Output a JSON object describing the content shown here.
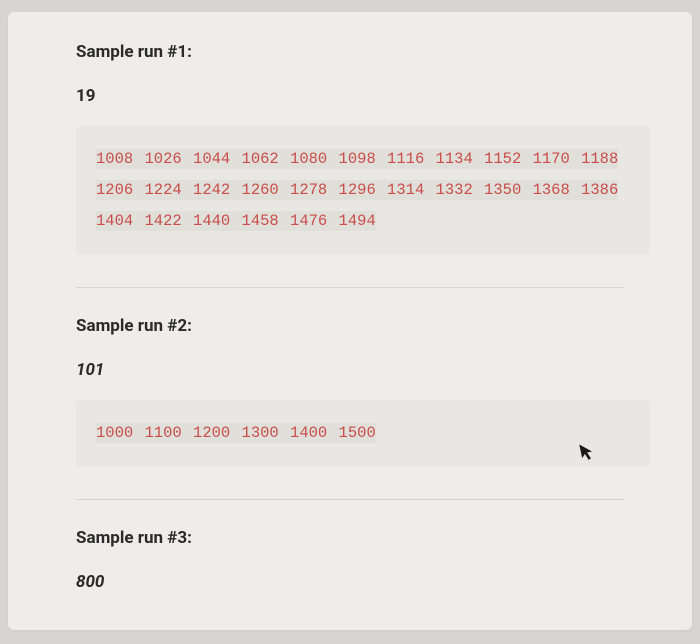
{
  "runs": [
    {
      "heading": "Sample run #1:",
      "input": "19",
      "input_italic": false,
      "output": "1008 1026 1044 1062 1080 1098 1116 1134 1152 1170 1188 1206 1224 1242 1260 1278 1296 1314 1332 1350 1368 1386 1404 1422 1440 1458 1476 1494"
    },
    {
      "heading": "Sample run #2:",
      "input": "101",
      "input_italic": true,
      "output": "1000 1100 1200 1300 1400 1500"
    },
    {
      "heading": "Sample run #3:",
      "input": "800",
      "input_italic": true,
      "output": null
    }
  ]
}
